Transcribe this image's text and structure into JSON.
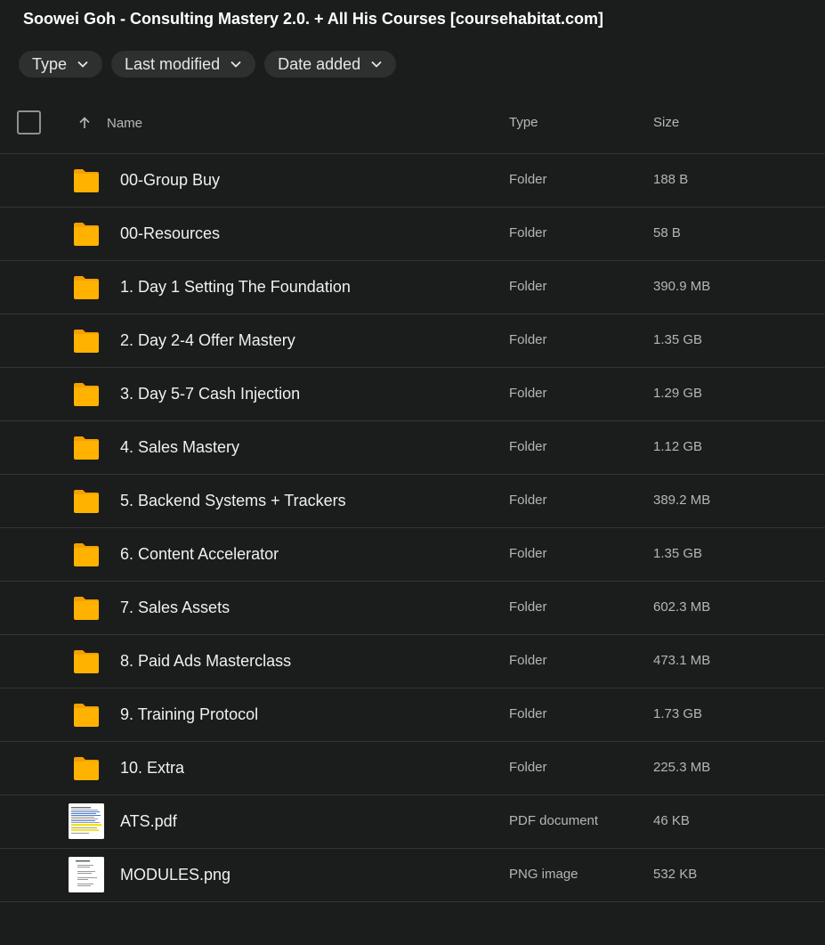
{
  "title": "Soowei Goh - Consulting Mastery 2.0. + All His Courses [coursehabitat.com]",
  "filters": [
    {
      "label": "Type",
      "icon": "chevron-down-icon"
    },
    {
      "label": "Last modified",
      "icon": "chevron-down-icon"
    },
    {
      "label": "Date added",
      "icon": "chevron-down-icon"
    }
  ],
  "table": {
    "columns": {
      "name": "Name",
      "type": "Type",
      "size": "Size"
    },
    "sort_icon": "arrow-up-icon",
    "rows": [
      {
        "name": "00-Group Buy",
        "type": "Folder",
        "size": "188 B",
        "icon": "folder-icon"
      },
      {
        "name": "00-Resources",
        "type": "Folder",
        "size": "58 B",
        "icon": "folder-icon"
      },
      {
        "name": "1. Day 1 Setting The Foundation",
        "type": "Folder",
        "size": "390.9 MB",
        "icon": "folder-icon"
      },
      {
        "name": "2. Day 2-4 Offer Mastery",
        "type": "Folder",
        "size": "1.35 GB",
        "icon": "folder-icon"
      },
      {
        "name": "3. Day 5-7 Cash Injection",
        "type": "Folder",
        "size": "1.29 GB",
        "icon": "folder-icon"
      },
      {
        "name": "4. Sales Mastery",
        "type": "Folder",
        "size": "1.12 GB",
        "icon": "folder-icon"
      },
      {
        "name": "5. Backend Systems + Trackers",
        "type": "Folder",
        "size": "389.2 MB",
        "icon": "folder-icon"
      },
      {
        "name": "6. Content Accelerator",
        "type": "Folder",
        "size": "1.35 GB",
        "icon": "folder-icon"
      },
      {
        "name": "7. Sales Assets",
        "type": "Folder",
        "size": "602.3 MB",
        "icon": "folder-icon"
      },
      {
        "name": "8. Paid Ads Masterclass",
        "type": "Folder",
        "size": "473.1 MB",
        "icon": "folder-icon"
      },
      {
        "name": "9. Training Protocol",
        "type": "Folder",
        "size": "1.73 GB",
        "icon": "folder-icon"
      },
      {
        "name": "10. Extra",
        "type": "Folder",
        "size": "225.3 MB",
        "icon": "folder-icon"
      },
      {
        "name": "ATS.pdf",
        "type": "PDF document",
        "size": "46 KB",
        "icon": "pdf-thumbnail"
      },
      {
        "name": "MODULES.png",
        "type": "PNG image",
        "size": "532 KB",
        "icon": "png-thumbnail"
      }
    ]
  },
  "colors": {
    "background": "#1b1c1c",
    "folder": "#ffb300",
    "folder_tab": "#f5a000",
    "chip": "#2e3030",
    "divider": "#343636"
  }
}
